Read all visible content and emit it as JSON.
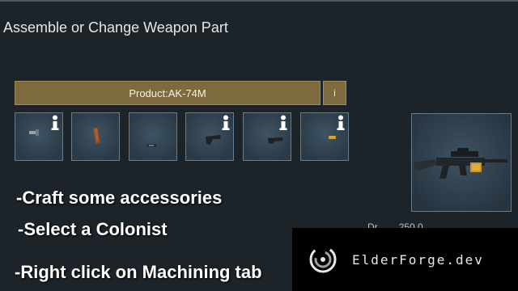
{
  "dialog": {
    "title": "Assemble or Change Weapon Part"
  },
  "product": {
    "label": "Product:AK-74M",
    "info_label": "i"
  },
  "slots": [
    {
      "icon": "muzzle-part-icon",
      "has_info": true
    },
    {
      "icon": "magazine-part-icon",
      "has_info": false
    },
    {
      "icon": "sight-part-icon",
      "has_info": false
    },
    {
      "icon": "stock-part-icon",
      "has_info": true
    },
    {
      "icon": "barrel-part-icon",
      "has_info": true
    },
    {
      "icon": "gold-accessory-icon",
      "has_info": true
    }
  ],
  "preview": {
    "icon": "rifle-preview-icon"
  },
  "partial_stat": "Dr...  ...  250.0 ...",
  "overlay": {
    "line1": "-Craft some accessories",
    "line2": "-Select a Colonist",
    "line3": "-Right click on Machining tab"
  },
  "watermark": {
    "text": "ElderForge.dev"
  },
  "colors": {
    "accent": "#7d6a3e",
    "slot_bg": "#2f4251",
    "background": "#1c2329"
  }
}
